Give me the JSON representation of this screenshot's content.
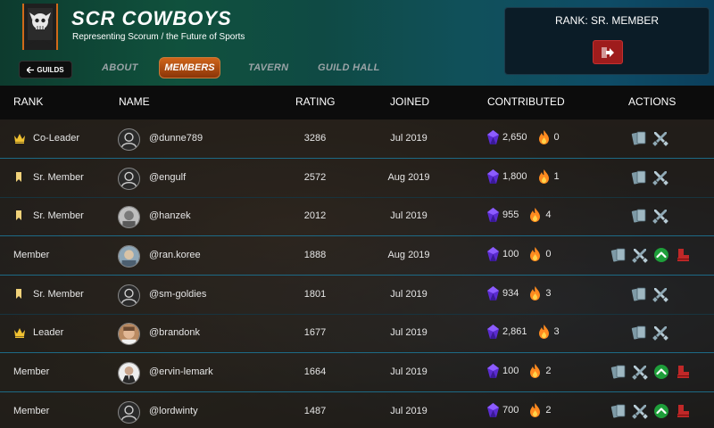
{
  "guild": {
    "name": "SCR COWBOYS",
    "subtitle": "Representing Scorum / the Future of Sports"
  },
  "nav": {
    "back_label": "GUILDS",
    "tabs": [
      {
        "label": "ABOUT",
        "active": false
      },
      {
        "label": "MEMBERS",
        "active": true
      },
      {
        "label": "TAVERN",
        "active": false
      },
      {
        "label": "GUILD HALL",
        "active": false
      }
    ]
  },
  "rank_panel": {
    "rank_text": "RANK: SR. MEMBER",
    "leave_icon": "exit-icon"
  },
  "table": {
    "headers": [
      "RANK",
      "NAME",
      "RATING",
      "JOINED",
      "CONTRIBUTED",
      "ACTIONS"
    ],
    "rows": [
      {
        "rank": "Co-Leader",
        "rank_icon": "crown-icon",
        "name": "@dunne789",
        "avatar": "default",
        "rating": "3286",
        "joined": "Jul 2019",
        "gems": "2,650",
        "power": "0",
        "actions": [
          "cards-icon",
          "swords-icon"
        ]
      },
      {
        "rank": "Sr. Member",
        "rank_icon": "bookmark-icon",
        "name": "@engulf",
        "avatar": "default",
        "rating": "2572",
        "joined": "Aug 2019",
        "gems": "1,800",
        "power": "1",
        "actions": [
          "cards-icon",
          "swords-icon"
        ]
      },
      {
        "rank": "Sr. Member",
        "rank_icon": "bookmark-icon",
        "name": "@hanzek",
        "avatar": "photo-gray",
        "rating": "2012",
        "joined": "Jul 2019",
        "gems": "955",
        "power": "4",
        "actions": [
          "cards-icon",
          "swords-icon"
        ]
      },
      {
        "rank": "Member",
        "rank_icon": "",
        "name": "@ran.koree",
        "avatar": "photo-blue",
        "rating": "1888",
        "joined": "Aug 2019",
        "gems": "100",
        "power": "0",
        "actions": [
          "cards-icon",
          "swords-icon",
          "promote-icon",
          "kick-icon"
        ]
      },
      {
        "rank": "Sr. Member",
        "rank_icon": "bookmark-icon",
        "name": "@sm-goldies",
        "avatar": "default",
        "rating": "1801",
        "joined": "Jul 2019",
        "gems": "934",
        "power": "3",
        "actions": [
          "cards-icon",
          "swords-icon"
        ]
      },
      {
        "rank": "Leader",
        "rank_icon": "crown-icon",
        "name": "@brandonk",
        "avatar": "photo-face",
        "rating": "1677",
        "joined": "Jul 2019",
        "gems": "2,861",
        "power": "3",
        "actions": [
          "cards-icon",
          "swords-icon"
        ]
      },
      {
        "rank": "Member",
        "rank_icon": "",
        "name": "@ervin-lemark",
        "avatar": "photo-suit",
        "rating": "1664",
        "joined": "Jul 2019",
        "gems": "100",
        "power": "2",
        "actions": [
          "cards-icon",
          "swords-icon",
          "promote-icon",
          "kick-icon"
        ]
      },
      {
        "rank": "Member",
        "rank_icon": "",
        "name": "@lordwinty",
        "avatar": "default",
        "rating": "1487",
        "joined": "Jul 2019",
        "gems": "700",
        "power": "2",
        "actions": [
          "cards-icon",
          "swords-icon",
          "promote-icon",
          "kick-icon"
        ]
      }
    ]
  },
  "colors": {
    "accent_orange": "#d0651a",
    "row_divider": "#1d6a86",
    "rank_gold": "#f1c232",
    "promote_green": "#1e9e3a",
    "kick_red": "#c02828"
  }
}
